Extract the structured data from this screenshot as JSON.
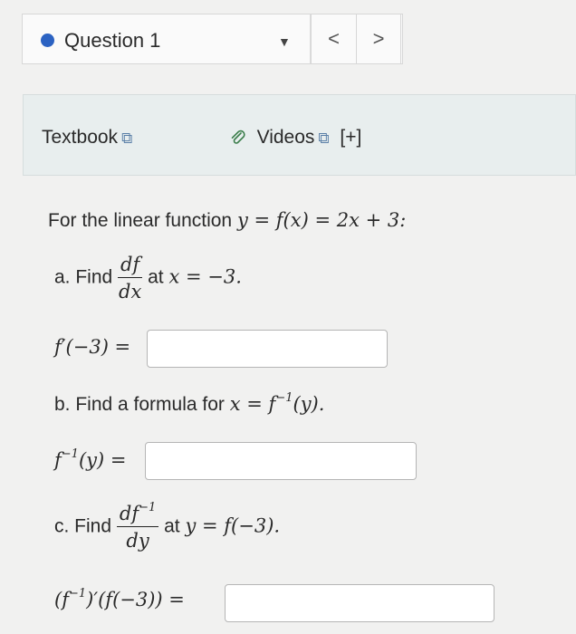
{
  "question_bar": {
    "title": "Question 1",
    "caret": "▼",
    "prev": "<",
    "next": ">"
  },
  "resources": {
    "textbook": "Textbook",
    "videos": "Videos",
    "plus": "[+]",
    "ext_icon": "⧉",
    "clip_icon": "⌀"
  },
  "problem": {
    "intro_text": "For the linear function",
    "intro_math": "y = f(x) = 2x + 3:",
    "a_prefix": "a. Find",
    "a_num": "df",
    "a_den": "dx",
    "a_suffix_text": "at",
    "a_suffix_math": "x = −3.",
    "a_answer_label": "f′(−3) =",
    "b_prefix": "b. Find a formula for",
    "b_math_pre": "x = f",
    "b_sup": "−1",
    "b_math_post": "(y).",
    "b_answer_pre": "f",
    "b_answer_sup": "−1",
    "b_answer_post": "(y) =",
    "c_prefix": "c. Find",
    "c_num": "df",
    "c_num_sup": "−1",
    "c_den": "dy",
    "c_suffix_text": "at",
    "c_suffix_math": "y = f(−3).",
    "c_answer_pre": "(f",
    "c_answer_sup": "−1",
    "c_answer_post": ")′(f(−3)) ="
  },
  "answers": {
    "a": "",
    "b": "",
    "c": ""
  }
}
